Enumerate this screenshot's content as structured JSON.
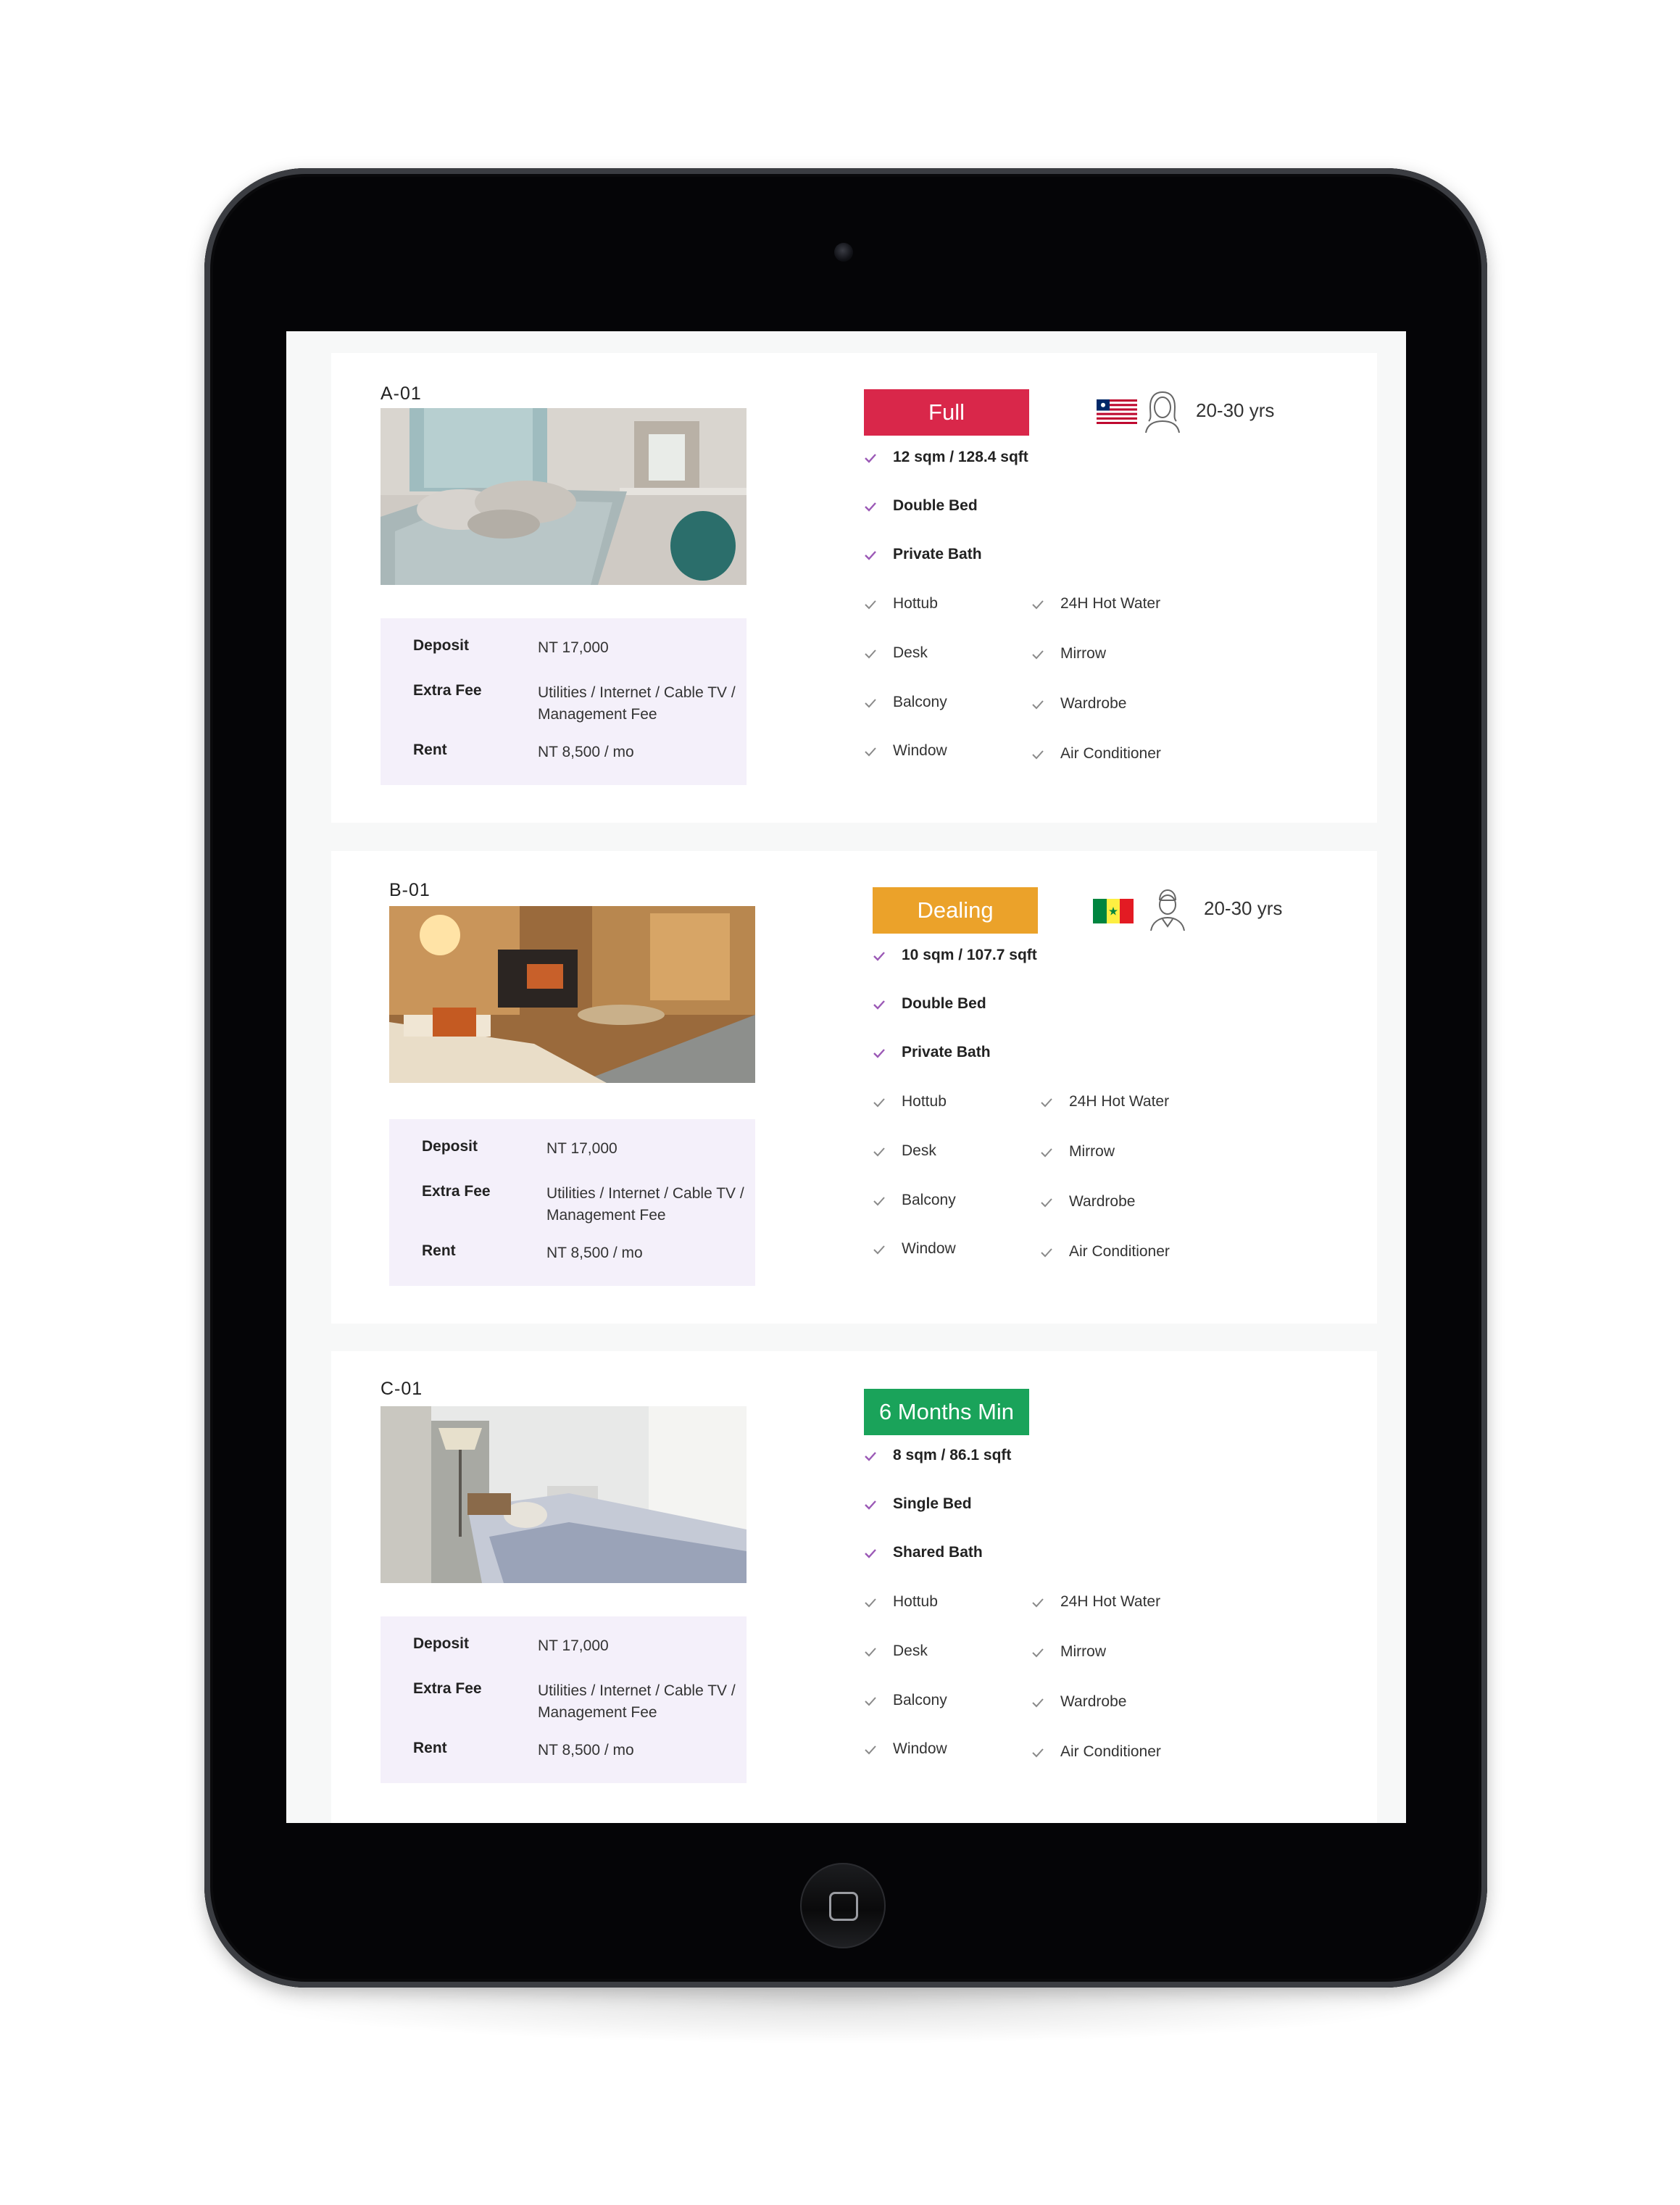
{
  "colors": {
    "full": "#d9274a",
    "dealing": "#eba22a",
    "min_months": "#1aa35a",
    "check_accent": "#9b59b6",
    "check_plain": "#8a8a8a",
    "info_bg": "#f4f0fa"
  },
  "rooms": [
    {
      "code": "A-01",
      "status": "Full",
      "status_color": "full",
      "flag": "liberia-flag",
      "gender": "female-icon",
      "age": "20-30 yrs",
      "features_main": [
        "12 sqm / 128.4 sqft",
        "Double Bed",
        "Private Bath"
      ],
      "amenities_left": [
        "Hottub",
        "Desk",
        "Balcony",
        "Window"
      ],
      "amenities_right": [
        "24H Hot Water",
        "Mirrow",
        "Wardrobe",
        "Air Conditioner"
      ],
      "deposit_label": "Deposit",
      "deposit_value": "NT 17,000",
      "extra_label": "Extra Fee",
      "extra_value": "Utilities / Internet / Cable TV / Management Fee",
      "rent_label": "Rent",
      "rent_value": "NT 8,500 / mo"
    },
    {
      "code": "B-01",
      "status": "Dealing",
      "status_color": "dealing",
      "flag": "senegal-flag",
      "gender": "male-icon",
      "age": "20-30 yrs",
      "features_main": [
        "10 sqm / 107.7 sqft",
        "Double Bed",
        "Private Bath"
      ],
      "amenities_left": [
        "Hottub",
        "Desk",
        "Balcony",
        "Window"
      ],
      "amenities_right": [
        "24H Hot Water",
        "Mirrow",
        "Wardrobe",
        "Air Conditioner"
      ],
      "deposit_label": "Deposit",
      "deposit_value": "NT 17,000",
      "extra_label": "Extra Fee",
      "extra_value": "Utilities / Internet / Cable TV / Management Fee",
      "rent_label": "Rent",
      "rent_value": "NT 8,500 / mo"
    },
    {
      "code": "C-01",
      "status": "6 Months Min",
      "status_color": "min_months",
      "features_main": [
        "8 sqm / 86.1 sqft",
        "Single Bed",
        "Shared Bath"
      ],
      "amenities_left": [
        "Hottub",
        "Desk",
        "Balcony",
        "Window"
      ],
      "amenities_right": [
        "24H Hot Water",
        "Mirrow",
        "Wardrobe",
        "Air Conditioner"
      ],
      "deposit_label": "Deposit",
      "deposit_value": "NT 17,000",
      "extra_label": "Extra Fee",
      "extra_value": "Utilities / Internet / Cable TV / Management Fee",
      "rent_label": "Rent",
      "rent_value": "NT 8,500 / mo"
    }
  ]
}
